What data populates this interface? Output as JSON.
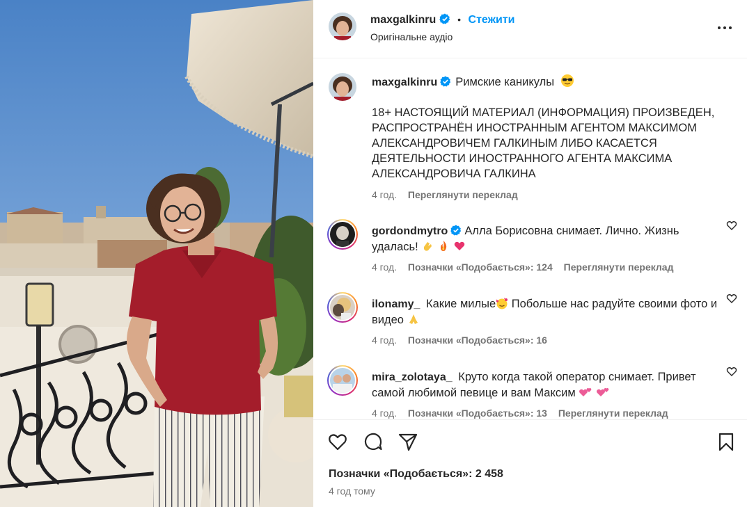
{
  "post": {
    "author": "maxgalkinru",
    "audio": "Оригінальне аудіо",
    "follow_label": "Стежити",
    "dot": "•"
  },
  "caption": {
    "author": "maxgalkinru",
    "title": "Римские каникулы",
    "disclaimer": "18+ НАСТОЯЩИЙ МАТЕРИАЛ (ИНФОРМАЦИЯ) ПРОИЗВЕДЕН, РАСПРОСТРАНЁН ИНОСТРАННЫМ АГЕНТОМ МАКСИМОМ АЛЕКСАНДРОВИЧЕМ ГАЛКИНЫМ ЛИБО КАСАЕТСЯ ДЕЯТЕЛЬНОСТИ ИНОСТРАННОГО АГЕНТА МАКСИМА АЛЕКСАНДРОВИЧА ГАЛКИНА",
    "age": "4 год.",
    "translate": "Переглянути переклад"
  },
  "comments": [
    {
      "user": "gordondmytro",
      "verified": true,
      "text": "Алла Борисовна снимает. Лично. Жизнь удалась!",
      "age": "4 год.",
      "likes": "Позначки «Подобається»: 124",
      "translate": "Переглянути переклад"
    },
    {
      "user": "ilonamy_",
      "verified": false,
      "text_a": "Какие милые",
      "text_b": "Побольше нас радуйте своими фото и видео",
      "age": "4 год.",
      "likes": "Позначки «Подобається»: 16"
    },
    {
      "user": "mira_zolotaya_",
      "verified": false,
      "text": "Круто когда такой оператор снимает. Привет самой любимой певице и вам Максим",
      "age": "4 год.",
      "likes": "Позначки «Подобається»: 13",
      "translate": "Переглянути переклад"
    }
  ],
  "footer": {
    "likes": "Позначки «Подобається»: 2 458",
    "time": "4 год тому"
  },
  "icons": {
    "like": "heart-icon",
    "comment": "comment-icon",
    "share": "share-icon",
    "save": "bookmark-icon",
    "more": "more-icon",
    "verified": "verified-badge-icon"
  },
  "colors": {
    "link_blue": "#0095f6",
    "text": "#262626",
    "secondary": "#737373",
    "verified": "#0095f6"
  }
}
